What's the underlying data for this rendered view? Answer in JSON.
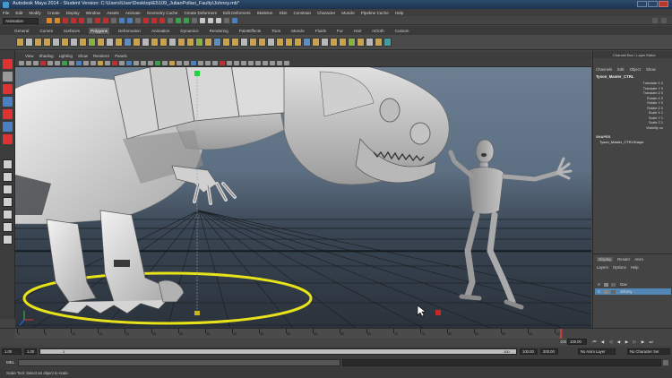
{
  "window": {
    "title": "Autodesk Maya 2014 - Student Version: C:\\Users\\User\\Desktop\\E5109_JulianPollari_Faulty\\Johnny.mb*"
  },
  "menu": [
    "File",
    "Edit",
    "Modify",
    "Create",
    "Display",
    "Window",
    "Assets",
    "Animate",
    "Geometry Cache",
    "Create Deformers",
    "Edit Deformers",
    "Skeleton",
    "Skin",
    "Constrain",
    "Character",
    "Muscle",
    "Pipeline Cache",
    "Help"
  ],
  "status": {
    "mode": "Animation"
  },
  "shelf_tabs": [
    "General",
    "Curves",
    "Surfaces",
    "Polygons",
    "Deformation",
    "Animation",
    "Dynamics",
    "Rendering",
    "PaintEffects",
    "Toon",
    "Muscle",
    "Fluids",
    "Fur",
    "Hair",
    "nCloth",
    "Custom"
  ],
  "shelf_active": "Polygons",
  "panel_menu": [
    "View",
    "Shading",
    "Lighting",
    "Show",
    "Renderer",
    "Panels"
  ],
  "channel_box": {
    "header": "Channel Box / Layer Editor",
    "tabs": [
      "Channels",
      "Edit",
      "Object",
      "Show"
    ],
    "object_name": "Tyson_Master_CTRL",
    "attributes": [
      "Translate X 0",
      "Translate Y 0",
      "Translate Z 0",
      "Rotate X 0",
      "Rotate Y 0",
      "Rotate Z 0",
      "Scale X 1",
      "Scale Y 1",
      "Scale Z 1",
      "Visibility on"
    ],
    "shapes_label": "SHAPES",
    "shape_name": "Tyson_Master_CTRLShape"
  },
  "layer_editor": {
    "tabs": [
      "Display",
      "Render",
      "Anim"
    ],
    "menu": [
      "Layers",
      "Options",
      "Help"
    ],
    "rows": [
      {
        "v": "V",
        "name": "Gav",
        "selected": false
      },
      {
        "v": "V",
        "name": "Johnny",
        "selected": true
      }
    ]
  },
  "timeline": {
    "ticks": [
      "1",
      "5",
      "10",
      "15",
      "20",
      "25",
      "30",
      "35",
      "40",
      "45",
      "50",
      "55",
      "60",
      "65",
      "70",
      "75",
      "80",
      "85",
      "90",
      "95",
      "100"
    ],
    "end_label": "100",
    "current_frame": "100.00",
    "range_start": "1.00",
    "range_inner_start": "1",
    "range_inner_end": "100",
    "range_end": "100.00",
    "range_end2": "200.00",
    "anim_layer": "No Anim Layer",
    "character_set": "No Character Set"
  },
  "command_line": {
    "label": "MEL"
  },
  "help_line": "Scale Tool: Select an object to scale.",
  "colors": {
    "accent": "#5286b4",
    "control_ring": "#e8e21a",
    "marker": "#c62828"
  }
}
